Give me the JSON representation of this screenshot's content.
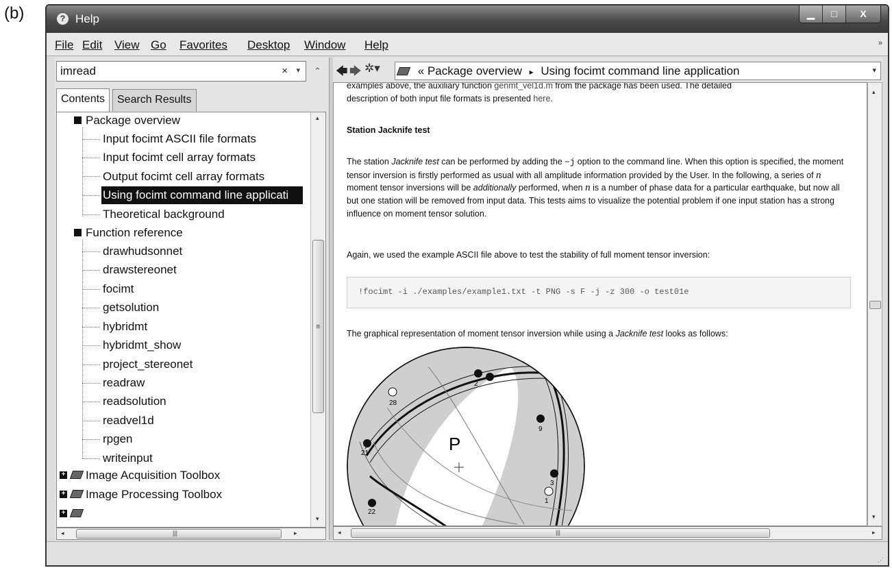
{
  "panel_label": "(b)",
  "window": {
    "title": "Help",
    "min_btn": "▁",
    "max_btn": "□",
    "close_btn": "X"
  },
  "menu": {
    "file": "File",
    "edit": "Edit",
    "view": "View",
    "go": "Go",
    "favorites": "Favorites",
    "desktop": "Desktop",
    "window": "Window",
    "help": "Help"
  },
  "search": {
    "value": "imread",
    "clear": "×",
    "dropdown": "▾",
    "collapse": "⌃"
  },
  "tabs": {
    "contents": "Contents",
    "search_results": "Search Results"
  },
  "tree": {
    "package_overview": "Package overview",
    "pkg_items": [
      "Input focimt ASCII file formats",
      "Input focimt cell array formats",
      "Output focimt cell array formats",
      "Using focimt command line applicati",
      "Theoretical background"
    ],
    "function_reference": "Function reference",
    "functions": [
      "drawhudsonnet",
      "drawstereonet",
      "focimt",
      "getsolution",
      "hybridmt",
      "hybridmt_show",
      "project_stereonet",
      "readraw",
      "readsolution",
      "readvel1d",
      "rpgen",
      "writeinput"
    ],
    "toolboxes": [
      "Image Acquisition Toolbox",
      "Image Processing Toolbox"
    ]
  },
  "nav": {
    "back": "🡄",
    "forward": "🡆",
    "gear": "✲▾",
    "double_chevron": "«",
    "crumb1": "Package overview",
    "separator": "▸",
    "crumb2": "Using focimt command line application",
    "dropdown": "▾"
  },
  "content": {
    "intro_line1a": "examples above, the auxiliary function ",
    "intro_link": "genmt_vel1d.m",
    "intro_line1b": " from the package has been used. The detailed",
    "intro_line2a": "description of both input file formats is presented ",
    "intro_here": "here",
    "intro_line2b": ".",
    "heading": "Station Jacknife test",
    "p1_a": "The station ",
    "p1_jack": "Jacknife test",
    "p1_b": " can be performed by adding the ",
    "p1_opt": "−j",
    "p1_c": " option to the command line. When this option is specified, the moment tensor inversion is firstly performed as usual with all amplitude information provided by the User. In the following, a series of ",
    "p1_n1": "n",
    "p1_d": " moment tensor inversions will be ",
    "p1_add": "additionally",
    "p1_e": " performed, when ",
    "p1_n2": "n",
    "p1_f": " is a number of phase data for a particular earthquake, but now all but one station will be removed from input data. This tests aims to visualize the potential problem if one input station has a strong influence on moment tensor solution.",
    "p2": "Again, we used the example ASCII file above to test the stability of full moment tensor inversion:",
    "code": "!focimt -i ./examples/example1.txt -t PNG -s F -j -z 300 -o test01e",
    "p3_a": "The graphical representation of moment tensor inversion while using a ",
    "p3_jack": "Jacknife test",
    "p3_b": " looks as follows:",
    "plot_label_P": "P",
    "stations": [
      "2",
      "28",
      "9",
      "21",
      "3",
      "1",
      "22"
    ]
  },
  "scroll": {
    "grip": "|||",
    "left": "◂",
    "right": "▸",
    "up": "▴",
    "down": "▾"
  },
  "status": {
    "grip": "⋰"
  }
}
